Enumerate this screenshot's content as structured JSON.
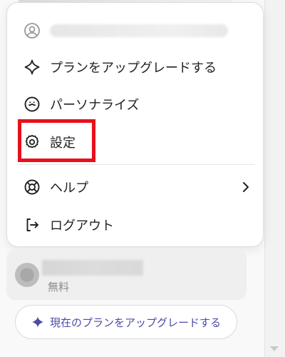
{
  "menu": {
    "upgrade_label": "プランをアップグレードする",
    "personalize_label": "パーソナライズ",
    "settings_label": "設定",
    "help_label": "ヘルプ",
    "logout_label": "ログアウト"
  },
  "account": {
    "plan_label": "無料"
  },
  "upgrade_button": {
    "label": "現在のプランをアップグレードする"
  },
  "colors": {
    "highlight": "#e8101b",
    "upgrade_accent": "#4b4aa8"
  },
  "icons": {
    "account": "person-circle-icon",
    "upgrade": "sparkle-icon",
    "personalize": "personalize-icon",
    "settings": "gear-icon",
    "help": "lifebuoy-icon",
    "help_chevron": "chevron-right-icon",
    "logout": "logout-icon",
    "upgrade_button": "sparkle-icon"
  }
}
